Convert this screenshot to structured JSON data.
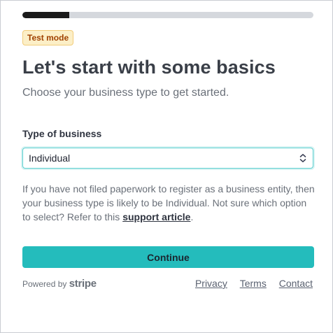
{
  "progress": {
    "fraction": 0.16
  },
  "badge": {
    "label": "Test mode"
  },
  "heading": {
    "title": "Let's start with some basics",
    "subtitle": "Choose your business type to get started."
  },
  "business_type": {
    "label": "Type of business",
    "selected": "Individual",
    "icon": "chevron-up-down-icon"
  },
  "help": {
    "text_before": "If you have not filed paperwork to register as a business entity, then your business type is likely to be Individual. Not sure which option to select? Refer to this ",
    "link": "support article",
    "text_after": "."
  },
  "actions": {
    "continue_label": "Continue"
  },
  "footer": {
    "powered_by": "Powered by ",
    "brand": "stripe",
    "links": [
      "Privacy",
      "Terms",
      "Contact"
    ]
  },
  "colors": {
    "accent": "#24bcbc",
    "progress_fill": "#1a1a1a",
    "progress_track": "#d5d8dd",
    "badge_bg": "#fcefc7",
    "badge_text": "#a04100"
  }
}
